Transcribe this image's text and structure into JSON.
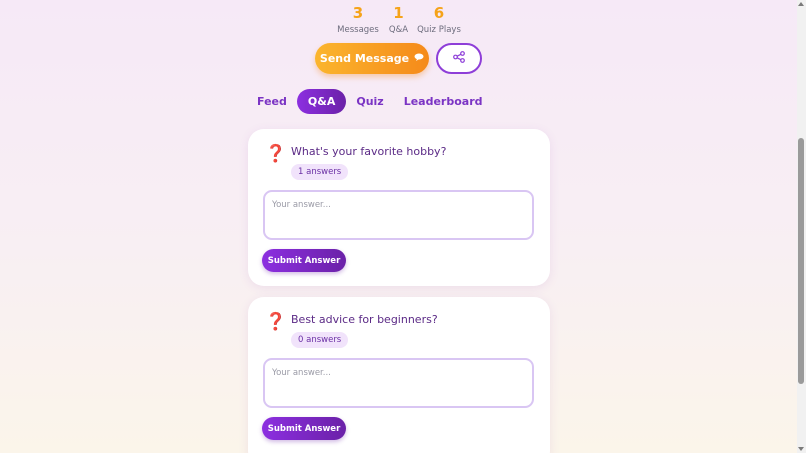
{
  "stats": [
    {
      "value": "3",
      "label": "Messages"
    },
    {
      "value": "1",
      "label": "Q&A"
    },
    {
      "value": "6",
      "label": "Quiz Plays"
    }
  ],
  "actions": {
    "send_label": "Send Message",
    "send_icon": "speech-bubble-icon",
    "share_icon": "share-icon"
  },
  "tabs": [
    {
      "label": "Feed",
      "active": false
    },
    {
      "label": "Q&A",
      "active": true
    },
    {
      "label": "Quiz",
      "active": false
    },
    {
      "label": "Leaderboard",
      "active": false
    }
  ],
  "questions": [
    {
      "icon": "question-mark-icon",
      "glyph": "❓",
      "text": "What's your favorite hobby?",
      "answers_badge": "1 answers",
      "input_placeholder": "Your answer...",
      "submit_label": "Submit Answer"
    },
    {
      "icon": "question-mark-icon",
      "glyph": "❓",
      "text": "Best advice for beginners?",
      "answers_badge": "0 answers",
      "input_placeholder": "Your answer...",
      "submit_label": "Submit Answer"
    }
  ],
  "colors": {
    "accent_purple": "#8c2fe0",
    "accent_orange": "#f58a1a",
    "stat_number": "#f5a31a",
    "question_icon": "#e0334f"
  }
}
